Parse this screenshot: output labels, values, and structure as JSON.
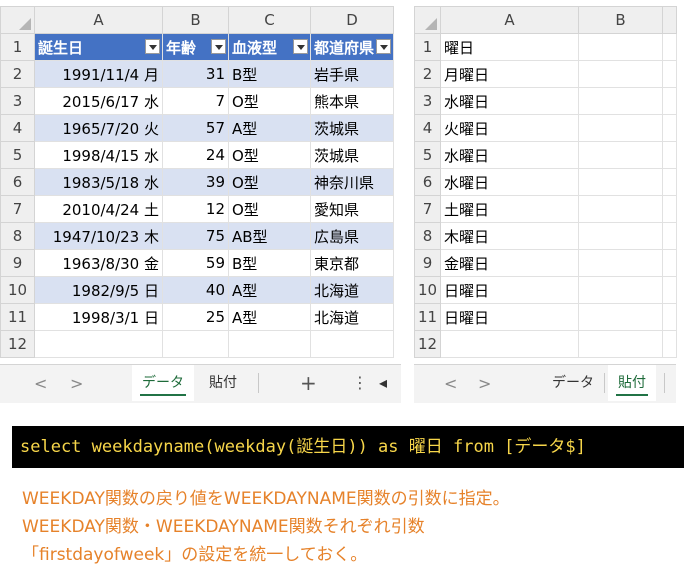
{
  "left_sheet": {
    "column_headers": [
      "A",
      "B",
      "C",
      "D"
    ],
    "table_headers": [
      "誕生日",
      "年齢",
      "血液型",
      "都道府県"
    ],
    "rows": [
      {
        "num": "1"
      },
      {
        "num": "2",
        "a": "1991/11/4 月",
        "b": "31",
        "c": "B型",
        "d": "岩手県"
      },
      {
        "num": "3",
        "a": "2015/6/17 水",
        "b": "7",
        "c": "O型",
        "d": "熊本県"
      },
      {
        "num": "4",
        "a": "1965/7/20 火",
        "b": "57",
        "c": "A型",
        "d": "茨城県"
      },
      {
        "num": "5",
        "a": "1998/4/15 水",
        "b": "24",
        "c": "O型",
        "d": "茨城県"
      },
      {
        "num": "6",
        "a": "1983/5/18 水",
        "b": "39",
        "c": "O型",
        "d": "神奈川県"
      },
      {
        "num": "7",
        "a": "2010/4/24 土",
        "b": "12",
        "c": "O型",
        "d": "愛知県"
      },
      {
        "num": "8",
        "a": "1947/10/23 木",
        "b": "75",
        "c": "AB型",
        "d": "広島県"
      },
      {
        "num": "9",
        "a": "1963/8/30 金",
        "b": "59",
        "c": "B型",
        "d": "東京都"
      },
      {
        "num": "10",
        "a": "1982/9/5 日",
        "b": "40",
        "c": "A型",
        "d": "北海道"
      },
      {
        "num": "11",
        "a": "1998/3/1 日",
        "b": "25",
        "c": "A型",
        "d": "北海道"
      },
      {
        "num": "12"
      }
    ],
    "tabs": {
      "prev": "<",
      "next": ">",
      "tab1": "データ",
      "tab2": "貼付",
      "add": "+",
      "more": "⋮",
      "scroll": "◂"
    }
  },
  "right_sheet": {
    "column_headers": [
      "A",
      "B"
    ],
    "rows": [
      {
        "num": "1",
        "a": "曜日"
      },
      {
        "num": "2",
        "a": "月曜日"
      },
      {
        "num": "3",
        "a": "水曜日"
      },
      {
        "num": "4",
        "a": "火曜日"
      },
      {
        "num": "5",
        "a": "水曜日"
      },
      {
        "num": "6",
        "a": "水曜日"
      },
      {
        "num": "7",
        "a": "土曜日"
      },
      {
        "num": "8",
        "a": "木曜日"
      },
      {
        "num": "9",
        "a": "金曜日"
      },
      {
        "num": "10",
        "a": "日曜日"
      },
      {
        "num": "11",
        "a": "日曜日"
      },
      {
        "num": "12",
        "a": ""
      }
    ],
    "tabs": {
      "prev": "<",
      "next": ">",
      "tab1": "データ",
      "tab2": "貼付"
    }
  },
  "sql": "select weekdayname(weekday(誕生日)) as 曜日 from [データ$]",
  "notes": {
    "line1": "WEEKDAY関数の戻り値をWEEKDAYNAME関数の引数に指定。",
    "line2": "WEEKDAY関数・WEEKDAYNAME関数それぞれ引数",
    "line3": "「firstdayofweek」の設定を統一しておく。"
  },
  "colors": {
    "table_header": "#4472c4",
    "band": "#d9e1f2",
    "sql_bg": "#000000",
    "sql_text": "#f7d64a",
    "note_text": "#e6822a",
    "active_tab": "#217346"
  }
}
